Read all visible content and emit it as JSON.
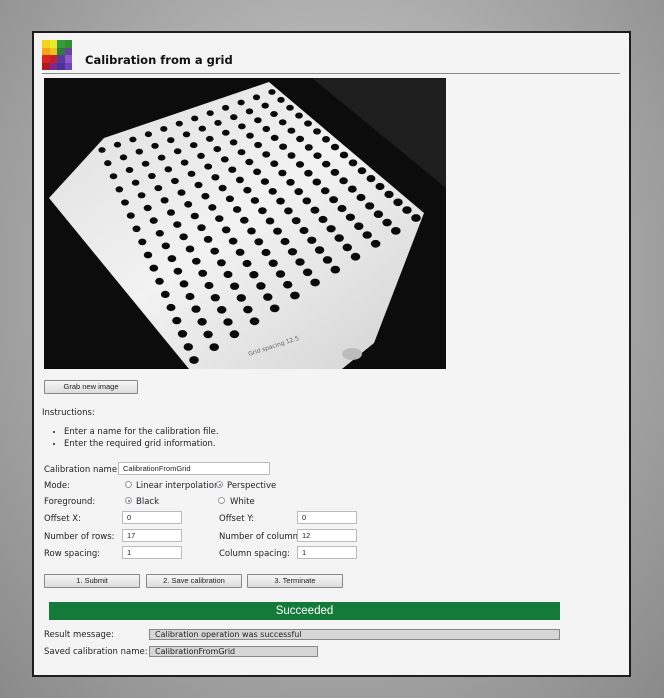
{
  "header": {
    "title": "Calibration from a grid"
  },
  "buttons": {
    "grab": "Grab new image",
    "submit": "1. Submit",
    "save": "2. Save calibration",
    "terminate": "3. Terminate"
  },
  "instructions": {
    "label": "Instructions:",
    "items": [
      "Enter a name for the calibration file.",
      "Enter the required grid information."
    ]
  },
  "form": {
    "calibration_name": {
      "label": "Calibration name:",
      "value": "CalibrationFromGrid"
    },
    "mode": {
      "label": "Mode:",
      "options": [
        "Linear interpolation",
        "Perspective"
      ],
      "selected": "Perspective"
    },
    "foreground": {
      "label": "Foreground:",
      "options": [
        "Black",
        "White"
      ],
      "selected": "Black"
    },
    "offset_x": {
      "label": "Offset X:",
      "value": "0"
    },
    "offset_y": {
      "label": "Offset Y:",
      "value": "0"
    },
    "rows": {
      "label": "Number of rows:",
      "value": "17"
    },
    "columns": {
      "label": "Number of columns:",
      "value": "12"
    },
    "row_spacing": {
      "label": "Row spacing:",
      "value": "1"
    },
    "column_spacing": {
      "label": "Column spacing:",
      "value": "1"
    }
  },
  "status": {
    "text": "Succeeded",
    "color": "#147a3a"
  },
  "result": {
    "label": "Result message:",
    "value": "Calibration operation was successful"
  },
  "saved": {
    "label": "Saved calibration name:",
    "value": "CalibrationFromGrid"
  },
  "camera": {
    "grid_rows": 17,
    "grid_columns": 12,
    "stamp_text": "Grid spacing 12.5"
  },
  "colors": {
    "background": "#f4f4f4",
    "border": "#1e1e1e"
  }
}
